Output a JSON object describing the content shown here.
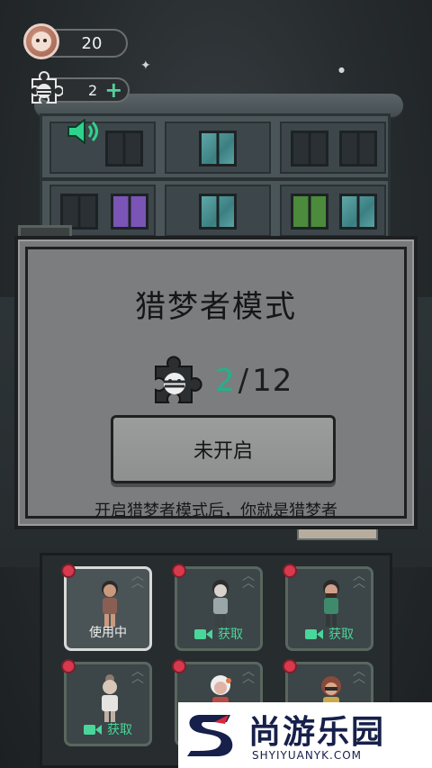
{
  "hud": {
    "coins_value": "20",
    "pieces_value": "2",
    "coin_icon": "ghost-face-coin-icon",
    "piece_icon": "puzzle-piece-icon",
    "add_icon": "plus-icon"
  },
  "sound_icon": "speaker-icon",
  "modal": {
    "title": "猎梦者模式",
    "progress_current": "2",
    "progress_separator": "/",
    "progress_total": "12",
    "button_label": "未开启",
    "description": "开启猎梦者模式后，你就是猎梦者"
  },
  "characters": [
    {
      "status": "使用中",
      "selected": true
    },
    {
      "status": "获取",
      "selected": false
    },
    {
      "status": "获取",
      "selected": false
    },
    {
      "status": "获取",
      "selected": false
    },
    {
      "status": "",
      "selected": false
    },
    {
      "status": "",
      "selected": false
    }
  ],
  "watermark": {
    "cn": "尚游乐园",
    "en": "SHYIYUANYK.COM"
  },
  "colors": {
    "accent_green": "#23b18c",
    "get_green": "#4ad59a",
    "badge_red": "#d9394d",
    "modal_bg": "#7b7d7e"
  }
}
